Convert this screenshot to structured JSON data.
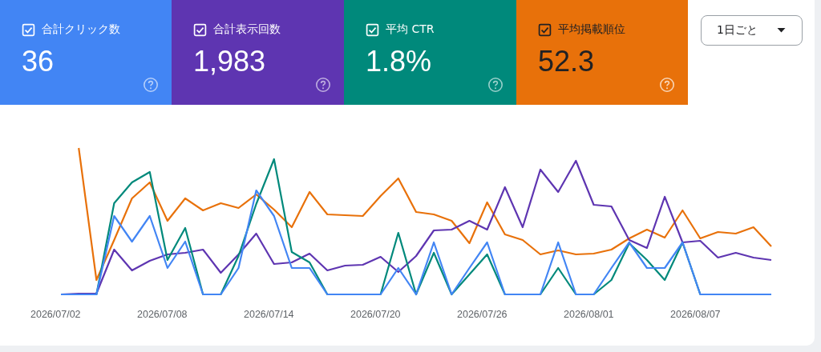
{
  "metrics": [
    {
      "label": "合計クリック数",
      "value": "36",
      "checked": true,
      "color": "#4285f4"
    },
    {
      "label": "合計表示回数",
      "value": "1,983",
      "checked": true,
      "color": "#5e35b1"
    },
    {
      "label": "平均 CTR",
      "value": "1.8%",
      "checked": true,
      "color": "#00897b"
    },
    {
      "label": "平均掲載順位",
      "value": "52.3",
      "checked": true,
      "color": "#e8710a"
    }
  ],
  "period_dropdown": {
    "value": "1日ごと"
  },
  "x_axis_labels": [
    "2026/07/02",
    "2026/07/08",
    "2026/07/14",
    "2026/07/20",
    "2026/07/26",
    "2026/08/01",
    "2026/08/07"
  ]
}
